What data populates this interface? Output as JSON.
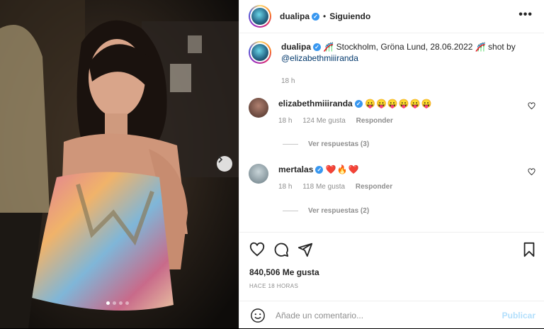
{
  "post": {
    "username": "dualipa",
    "separator": "•",
    "follow_status": "Siguiendo",
    "more_icon": "•••",
    "caption_prefix": "🎢 Stockholm, Gröna Lund, 28.06.2022 🎢 shot by",
    "caption_mention": "@elizabethmiiiranda",
    "caption_time": "18 h",
    "carousel_dots": 4,
    "carousel_active": 0
  },
  "comments": [
    {
      "username": "elizabethmiiiranda",
      "text": "😛😛😛😛😛😛",
      "time": "18 h",
      "likes": "124 Me gusta",
      "reply_label": "Responder",
      "view_replies": "Ver respuestas (3)",
      "avatar_color": "#6b4a3a"
    },
    {
      "username": "mertalas",
      "text": "❤️🔥❤️",
      "time": "18 h",
      "likes": "118 Me gusta",
      "reply_label": "Responder",
      "view_replies": "Ver respuestas (2)",
      "avatar_color": "#8aa0a8"
    }
  ],
  "footer": {
    "likes_count": "840,506 Me gusta",
    "time_ago": "HACE 18 HORAS",
    "comment_placeholder": "Añade un comentario...",
    "publish_label": "Publicar"
  },
  "icons": {
    "like": "heart-icon",
    "comment": "comment-icon",
    "share": "share-icon",
    "save": "bookmark-icon",
    "emoji": "emoji-icon",
    "next": "chevron-right-icon"
  },
  "colors": {
    "verified": "#3897f0",
    "publish_disabled": "#b2dffc",
    "muted": "#8e8e8e"
  }
}
